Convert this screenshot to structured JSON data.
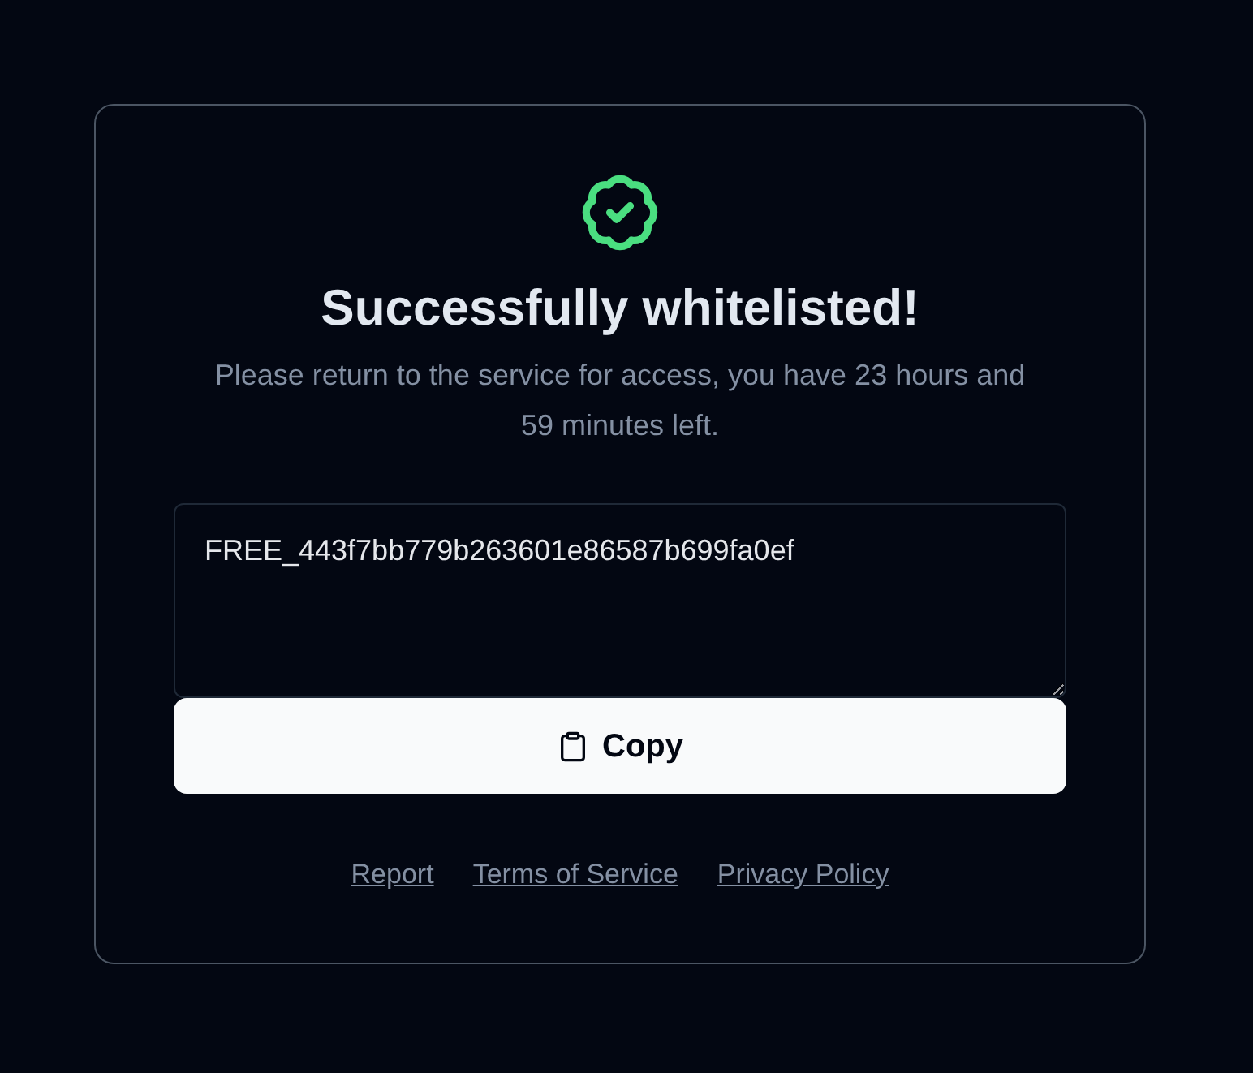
{
  "card": {
    "title": "Successfully whitelisted!",
    "message": "Please return to the service for access, you have 23 hours and 59 minutes left.",
    "code_field": {
      "value": "FREE_443f7bb779b263601e86587b699fa0ef"
    },
    "copy_button": {
      "label": "Copy"
    },
    "footer_links": [
      "Report",
      "Terms of Service",
      "Privacy Policy"
    ]
  }
}
